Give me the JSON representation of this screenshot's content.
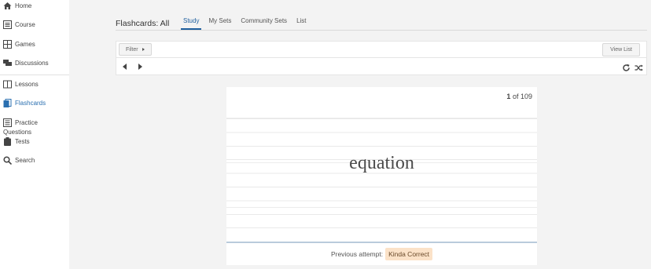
{
  "sidebar": {
    "items": [
      {
        "label": "Home",
        "icon": "home-icon"
      },
      {
        "label": "Course",
        "icon": "course-icon"
      },
      {
        "label": "Games",
        "icon": "games-icon"
      },
      {
        "label": "Discussions",
        "icon": "discussions-icon"
      },
      {
        "label": "Lessons",
        "icon": "lessons-icon"
      },
      {
        "label": "Flashcards",
        "icon": "flashcards-icon",
        "active": true
      },
      {
        "label": "Practice Questions",
        "label_line1": "Practice",
        "label_line2": "Questions",
        "icon": "practice-questions-icon"
      },
      {
        "label": "Tests",
        "icon": "tests-icon"
      },
      {
        "label": "Search",
        "icon": "search-icon"
      }
    ]
  },
  "header": {
    "title": "Flashcards: All",
    "tabs": [
      {
        "label": "Study",
        "active": true
      },
      {
        "label": "My Sets"
      },
      {
        "label": "Community Sets"
      },
      {
        "label": "List"
      }
    ]
  },
  "toolbar": {
    "filter_label": "Filter",
    "view_list_label": "View List",
    "icons": [
      "prev-arrow-icon",
      "next-arrow-icon",
      "refresh-icon",
      "shuffle-icon"
    ]
  },
  "card": {
    "current": "1",
    "of_label": "of",
    "total": "109",
    "term": "equation"
  },
  "footer": {
    "previous_attempt_label": "Previous attempt:",
    "previous_attempt_value": "Kinda Correct"
  },
  "colors": {
    "accent": "#1f5f9e",
    "badge_bg": "#fbe2c8",
    "sidebar_bg": "#ffffff",
    "page_bg": "#f3f3f3"
  }
}
